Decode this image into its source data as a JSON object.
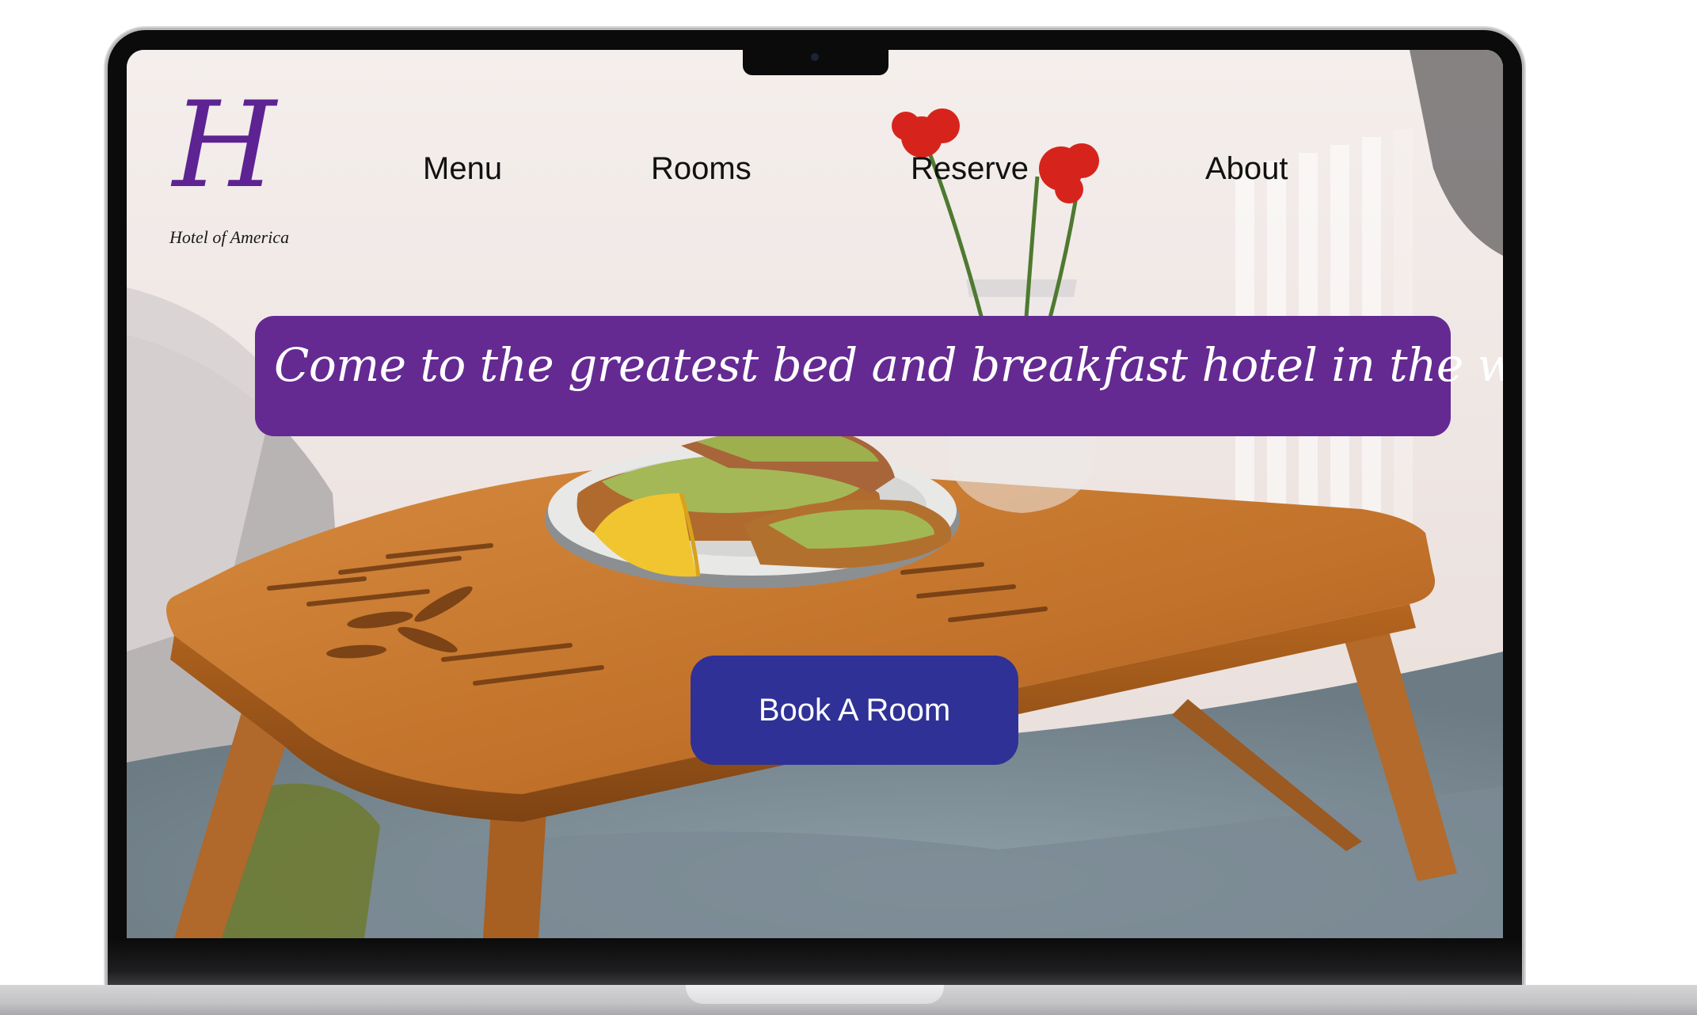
{
  "brand": {
    "logo_letter": "H",
    "logo_caption": "Hotel of America"
  },
  "nav": {
    "items": [
      {
        "label": "Menu"
      },
      {
        "label": "Rooms"
      },
      {
        "label": "Reserve"
      },
      {
        "label": "About"
      }
    ]
  },
  "hero": {
    "headline": "Come to the greatest bed and breakfast hotel in the world.",
    "cta_label": "Book A Room"
  },
  "colors": {
    "brand_purple": "#642a92",
    "cta_blue": "#2f3196",
    "logo_purple": "#5d2393"
  }
}
